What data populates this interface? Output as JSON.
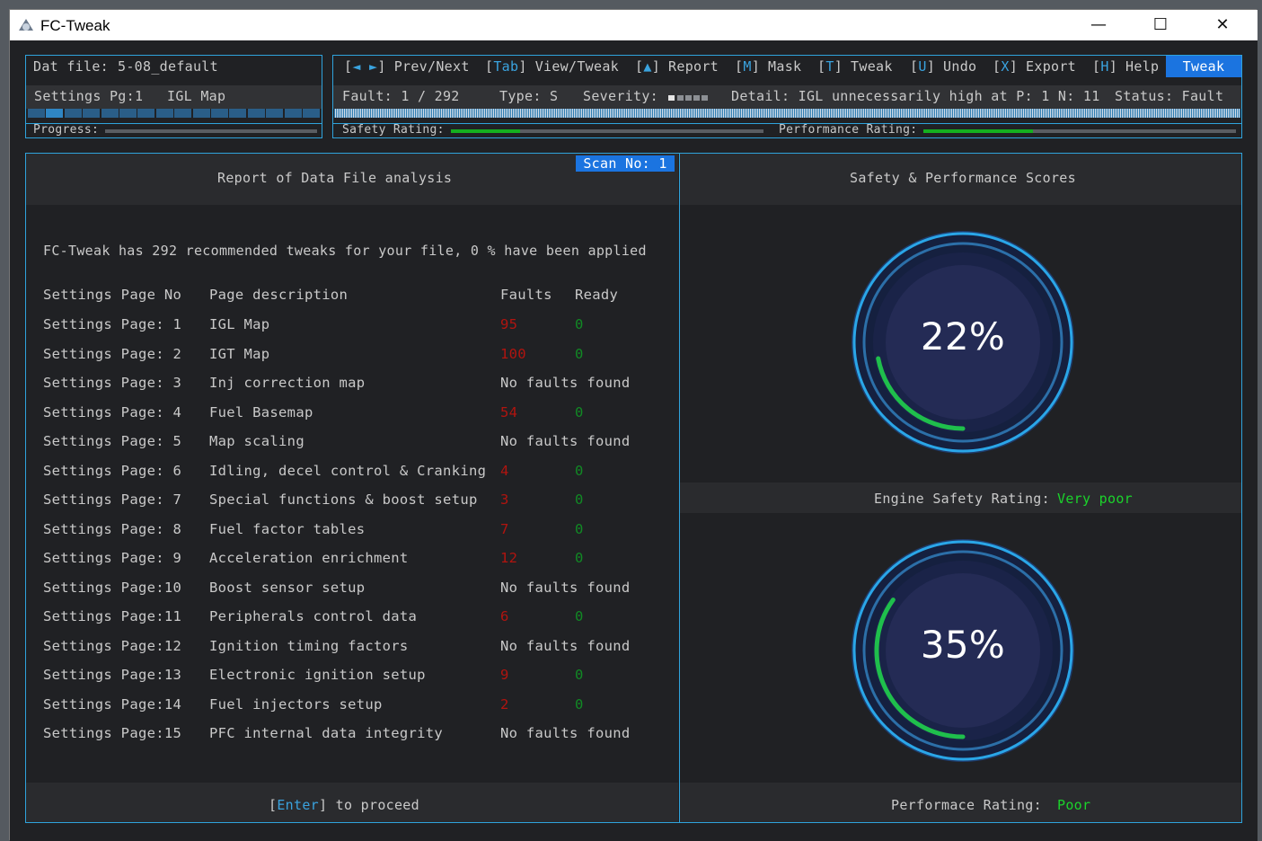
{
  "window": {
    "title": "FC-Tweak",
    "min": "—",
    "max": "☐",
    "close": "✕"
  },
  "top": {
    "dat_label": "Dat file:",
    "dat_value": "5-08_default",
    "settings_pg": "Settings Pg:1",
    "settings_name": "IGL Map",
    "progress_label": "Progress:",
    "nav": [
      {
        "k": "[",
        "ka": "◄ ►",
        "kb": "]",
        "label": "Prev/Next"
      },
      {
        "k": "[",
        "ka": "Tab",
        "kb": "]",
        "label": "View/Tweak"
      },
      {
        "k": "[",
        "ka": "▲",
        "kb": "]",
        "label": "Report"
      },
      {
        "k": "[",
        "ka": "M",
        "kb": "]",
        "label": "Mask"
      },
      {
        "k": "[",
        "ka": "T",
        "kb": "]",
        "label": "Tweak"
      },
      {
        "k": "[",
        "ka": "U",
        "kb": "]",
        "label": "Undo"
      },
      {
        "k": "[",
        "ka": "X",
        "kb": "]",
        "label": "Export"
      },
      {
        "k": "[",
        "ka": "H",
        "kb": "]",
        "label": "Help"
      }
    ],
    "mode": "Tweak",
    "fault": "Fault: 1 / 292",
    "type": "Type: S",
    "severity": "Severity:",
    "detail": "Detail: IGL unnecessarily high at P: 1 N: 11",
    "status": "Status: Fault",
    "safety_label": "Safety Rating:",
    "performance_label": "Performance Rating:",
    "safety_level": 0.22,
    "performance_level": 0.35
  },
  "report": {
    "scan": "Scan No: 1",
    "title": "Report of Data File analysis",
    "summary": "FC-Tweak has 292 recommended tweaks for your file, 0 % have been applied",
    "headers": [
      "Settings Page No",
      "Page description",
      "Faults",
      "Ready"
    ],
    "rows": [
      {
        "no": "Settings Page: 1",
        "desc": "IGL Map",
        "faults": "95",
        "ready": "0"
      },
      {
        "no": "Settings Page: 2",
        "desc": "IGT Map",
        "faults": "100",
        "ready": "0"
      },
      {
        "no": "Settings Page: 3",
        "desc": "Inj correction map",
        "nofault": "No faults found"
      },
      {
        "no": "Settings Page: 4",
        "desc": "Fuel Basemap",
        "faults": "54",
        "ready": "0"
      },
      {
        "no": "Settings Page: 5",
        "desc": "Map scaling",
        "nofault": "No faults found"
      },
      {
        "no": "Settings Page: 6",
        "desc": "Idling, decel control & Cranking",
        "faults": "4",
        "ready": "0"
      },
      {
        "no": "Settings Page: 7",
        "desc": "Special functions & boost setup",
        "faults": "3",
        "ready": "0"
      },
      {
        "no": "Settings Page: 8",
        "desc": "Fuel factor tables",
        "faults": "7",
        "ready": "0"
      },
      {
        "no": "Settings Page: 9",
        "desc": "Acceleration enrichment",
        "faults": "12",
        "ready": "0"
      },
      {
        "no": "Settings Page:10",
        "desc": "Boost sensor setup",
        "nofault": "No faults found"
      },
      {
        "no": "Settings Page:11",
        "desc": "Peripherals control data",
        "faults": "6",
        "ready": "0"
      },
      {
        "no": "Settings Page:12",
        "desc": "Ignition timing factors",
        "nofault": "No faults found"
      },
      {
        "no": "Settings Page:13",
        "desc": "Electronic ignition setup",
        "faults": "9",
        "ready": "0"
      },
      {
        "no": "Settings Page:14",
        "desc": "Fuel injectors setup",
        "faults": "2",
        "ready": "0"
      },
      {
        "no": "Settings Page:15",
        "desc": "PFC internal data integrity",
        "nofault": "No faults found"
      }
    ],
    "enter_open": "[",
    "enter_key": "Enter",
    "enter_rest": "] to proceed"
  },
  "scores": {
    "title": "Safety & Performance Scores",
    "safety_pct": "22%",
    "safety_value": 22,
    "safety_label": "Engine Safety Rating:",
    "safety_word": "Very poor",
    "perf_pct": "35%",
    "perf_value": 35,
    "perf_label": "Performace Rating:",
    "perf_word": "Poor"
  },
  "colors": {
    "accent": "#2fa3dc",
    "highlight": "#1b74e0",
    "good": "#15b01f",
    "bad": "#b1140f"
  }
}
